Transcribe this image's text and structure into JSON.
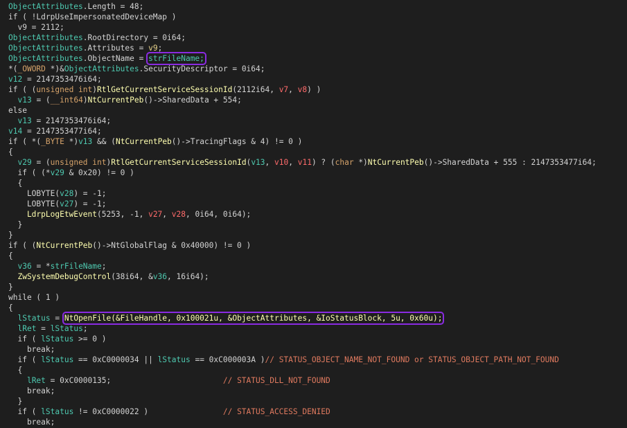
{
  "colors": {
    "background": "#1e1e1e",
    "highlight": "#8a2be2",
    "variable": "#4ec9b0",
    "comment": "#e07a5f"
  },
  "code": {
    "lines": [
      [
        {
          "t": "ObjectAttributes",
          "c": "var"
        },
        {
          "t": ".Length = 48;",
          "c": "txt"
        }
      ],
      [
        {
          "t": "if ( !LdrpUseImpersonatedDeviceMap )",
          "c": "txt"
        }
      ],
      [
        {
          "t": "  v9 = 2112;",
          "c": "txt"
        }
      ],
      [
        {
          "t": "ObjectAttributes",
          "c": "var"
        },
        {
          "t": ".RootDirectory = 0i64;",
          "c": "txt"
        }
      ],
      [
        {
          "t": "ObjectAttributes",
          "c": "var"
        },
        {
          "t": ".Attributes = ",
          "c": "txt"
        },
        {
          "t": "v9",
          "c": "par"
        },
        {
          "t": ";",
          "c": "txt"
        }
      ],
      [
        {
          "t": "ObjectAttributes",
          "c": "var"
        },
        {
          "t": ".ObjectName = ",
          "c": "txt"
        },
        {
          "t": "strFileName;",
          "c": "var",
          "hl": true
        }
      ],
      [
        {
          "t": "*(",
          "c": "txt"
        },
        {
          "t": "_OWORD",
          "c": "kw"
        },
        {
          "t": " *)&",
          "c": "txt"
        },
        {
          "t": "ObjectAttributes",
          "c": "var"
        },
        {
          "t": ".SecurityDescriptor = 0i64;",
          "c": "txt"
        }
      ],
      [
        {
          "t": "v12",
          "c": "var"
        },
        {
          "t": " = 2147353476i64;",
          "c": "txt"
        }
      ],
      [
        {
          "t": "if ( (",
          "c": "txt"
        },
        {
          "t": "unsigned int",
          "c": "kw"
        },
        {
          "t": ")",
          "c": "txt"
        },
        {
          "t": "RtlGetCurrentServiceSessionId",
          "c": "fn"
        },
        {
          "t": "(2112i64, ",
          "c": "txt"
        },
        {
          "t": "v7",
          "c": "red"
        },
        {
          "t": ", ",
          "c": "txt"
        },
        {
          "t": "v8",
          "c": "red"
        },
        {
          "t": ") )",
          "c": "txt"
        }
      ],
      [
        {
          "t": "  ",
          "c": "txt"
        },
        {
          "t": "v13",
          "c": "var"
        },
        {
          "t": " = (",
          "c": "txt"
        },
        {
          "t": "__int64",
          "c": "kw"
        },
        {
          "t": ")",
          "c": "txt"
        },
        {
          "t": "NtCurrentPeb",
          "c": "fn"
        },
        {
          "t": "()->SharedData + 554;",
          "c": "txt"
        }
      ],
      [
        {
          "t": "else",
          "c": "txt"
        }
      ],
      [
        {
          "t": "  ",
          "c": "txt"
        },
        {
          "t": "v13",
          "c": "var"
        },
        {
          "t": " = 2147353476i64;",
          "c": "txt"
        }
      ],
      [
        {
          "t": "v14",
          "c": "var"
        },
        {
          "t": " = 2147353477i64;",
          "c": "txt"
        }
      ],
      [
        {
          "t": "if ( *(",
          "c": "txt"
        },
        {
          "t": "_BYTE",
          "c": "kw"
        },
        {
          "t": " *)",
          "c": "txt"
        },
        {
          "t": "v13",
          "c": "var"
        },
        {
          "t": " && (",
          "c": "txt"
        },
        {
          "t": "NtCurrentPeb",
          "c": "fn"
        },
        {
          "t": "()->TracingFlags & 4) != 0 )",
          "c": "txt"
        }
      ],
      [
        {
          "t": "{",
          "c": "txt"
        }
      ],
      [
        {
          "t": "  ",
          "c": "txt"
        },
        {
          "t": "v29",
          "c": "var"
        },
        {
          "t": " = (",
          "c": "txt"
        },
        {
          "t": "unsigned int",
          "c": "kw"
        },
        {
          "t": ")",
          "c": "txt"
        },
        {
          "t": "RtlGetCurrentServiceSessionId",
          "c": "fn"
        },
        {
          "t": "(",
          "c": "txt"
        },
        {
          "t": "v13",
          "c": "var"
        },
        {
          "t": ", ",
          "c": "txt"
        },
        {
          "t": "v10",
          "c": "red"
        },
        {
          "t": ", ",
          "c": "txt"
        },
        {
          "t": "v11",
          "c": "red"
        },
        {
          "t": ") ? (",
          "c": "txt"
        },
        {
          "t": "char",
          "c": "kw"
        },
        {
          "t": " *)",
          "c": "txt"
        },
        {
          "t": "NtCurrentPeb",
          "c": "fn"
        },
        {
          "t": "()->SharedData + 555 : 2147353477i64;",
          "c": "txt"
        }
      ],
      [
        {
          "t": "  if ( (*",
          "c": "txt"
        },
        {
          "t": "v29",
          "c": "var"
        },
        {
          "t": " & 0x20) != 0 )",
          "c": "txt"
        }
      ],
      [
        {
          "t": "  {",
          "c": "txt"
        }
      ],
      [
        {
          "t": "    LOBYTE(",
          "c": "txt"
        },
        {
          "t": "v28",
          "c": "var"
        },
        {
          "t": ") = -1;",
          "c": "txt"
        }
      ],
      [
        {
          "t": "    LOBYTE(",
          "c": "txt"
        },
        {
          "t": "v27",
          "c": "var"
        },
        {
          "t": ") = -1;",
          "c": "txt"
        }
      ],
      [
        {
          "t": "    LdrpLogEtwEvent",
          "c": "fn"
        },
        {
          "t": "(5253, -1, ",
          "c": "txt"
        },
        {
          "t": "v27",
          "c": "red"
        },
        {
          "t": ", ",
          "c": "txt"
        },
        {
          "t": "v28",
          "c": "red"
        },
        {
          "t": ", 0i64, 0i64);",
          "c": "txt"
        }
      ],
      [
        {
          "t": "  }",
          "c": "txt"
        }
      ],
      [
        {
          "t": "}",
          "c": "txt"
        }
      ],
      [
        {
          "t": "if ( (",
          "c": "txt"
        },
        {
          "t": "NtCurrentPeb",
          "c": "fn"
        },
        {
          "t": "()->NtGlobalFlag & 0x40000) != 0 )",
          "c": "txt"
        }
      ],
      [
        {
          "t": "{",
          "c": "txt"
        }
      ],
      [
        {
          "t": "  ",
          "c": "txt"
        },
        {
          "t": "v36",
          "c": "var"
        },
        {
          "t": " = *",
          "c": "txt"
        },
        {
          "t": "strFileName",
          "c": "var"
        },
        {
          "t": ";",
          "c": "txt"
        }
      ],
      [
        {
          "t": "  ZwSystemDebugControl",
          "c": "fn"
        },
        {
          "t": "(38i64, &",
          "c": "txt"
        },
        {
          "t": "v36",
          "c": "var"
        },
        {
          "t": ", 16i64);",
          "c": "txt"
        }
      ],
      [
        {
          "t": "}",
          "c": "txt"
        }
      ],
      [
        {
          "t": "while ( 1 )",
          "c": "txt"
        }
      ],
      [
        {
          "t": "{",
          "c": "txt"
        }
      ],
      [
        {
          "t": "  ",
          "c": "txt"
        },
        {
          "t": "lStatus",
          "c": "var"
        },
        {
          "t": " = ",
          "c": "txt"
        },
        {
          "t": "NtOpenFile(&FileHandle, 0x100021u, &ObjectAttributes, &IoStatusBlock, 5u, 0x60u);",
          "c": "fn",
          "hl": true
        }
      ],
      [
        {
          "t": "  ",
          "c": "txt"
        },
        {
          "t": "lRet",
          "c": "var"
        },
        {
          "t": " = ",
          "c": "txt"
        },
        {
          "t": "lStatus",
          "c": "var"
        },
        {
          "t": ";",
          "c": "txt"
        }
      ],
      [
        {
          "t": "  if ( ",
          "c": "txt"
        },
        {
          "t": "lStatus",
          "c": "var"
        },
        {
          "t": " >= 0 )",
          "c": "txt"
        }
      ],
      [
        {
          "t": "    break;",
          "c": "txt"
        }
      ],
      [
        {
          "t": "  if ( ",
          "c": "txt"
        },
        {
          "t": "lStatus",
          "c": "var"
        },
        {
          "t": " == 0xC0000034 || ",
          "c": "txt"
        },
        {
          "t": "lStatus",
          "c": "var"
        },
        {
          "t": " == 0xC000003A )",
          "c": "txt"
        },
        {
          "t": "// STATUS_OBJECT_NAME_NOT_FOUND or STATUS_OBJECT_PATH_NOT_FOUND",
          "c": "com"
        }
      ],
      [
        {
          "t": "  {",
          "c": "txt"
        }
      ],
      [
        {
          "t": "    ",
          "c": "txt"
        },
        {
          "t": "lRet",
          "c": "var"
        },
        {
          "t": " = 0xC0000135;                        ",
          "c": "txt"
        },
        {
          "t": "// STATUS_DLL_NOT_FOUND",
          "c": "com"
        }
      ],
      [
        {
          "t": "    break;",
          "c": "txt"
        }
      ],
      [
        {
          "t": "  }",
          "c": "txt"
        }
      ],
      [
        {
          "t": "  if ( ",
          "c": "txt"
        },
        {
          "t": "lStatus",
          "c": "var"
        },
        {
          "t": " != 0xC0000022 )                ",
          "c": "txt"
        },
        {
          "t": "// STATUS_ACCESS_DENIED",
          "c": "com"
        }
      ],
      [
        {
          "t": "    break;",
          "c": "txt"
        }
      ]
    ]
  }
}
